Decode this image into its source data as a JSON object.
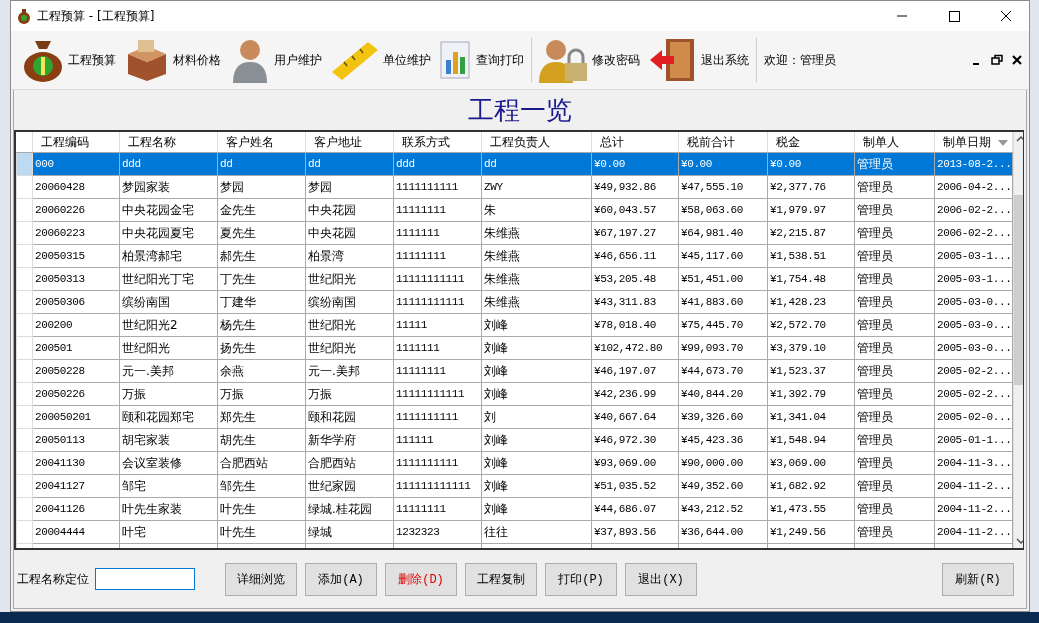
{
  "window": {
    "title": "工程预算 - [工程预算]"
  },
  "toolbar": [
    {
      "kind": "money",
      "label": "工程预算"
    },
    {
      "kind": "box",
      "label": "材料价格"
    },
    {
      "kind": "user",
      "label": "用户维护"
    },
    {
      "kind": "ruler",
      "label": "单位维护"
    },
    {
      "kind": "chart",
      "label": "查询打印"
    },
    {
      "kind": "lock",
      "label": "修改密码"
    },
    {
      "kind": "exit",
      "label": "退出系统"
    }
  ],
  "welcome": "欢迎：管理员",
  "heading": "工程一览",
  "table": {
    "columns": [
      "工程编码",
      "工程名称",
      "客户姓名",
      "客户地址",
      "联系方式",
      "工程负责人",
      "总计",
      "税前合计",
      "税金",
      "制单人",
      "制单日期"
    ],
    "rows": [
      {
        "selected": true,
        "cells": [
          "000",
          "ddd",
          "dd",
          "dd",
          "ddd",
          "dd",
          "¥0.00",
          "¥0.00",
          "¥0.00",
          "管理员",
          "2013-08-2..."
        ]
      },
      {
        "selected": false,
        "cells": [
          "20060428",
          "梦园家装",
          "梦园",
          "梦园",
          "1111111111",
          "ZWY",
          "¥49,932.86",
          "¥47,555.10",
          "¥2,377.76",
          "管理员",
          "2006-04-2..."
        ]
      },
      {
        "selected": false,
        "cells": [
          "20060226",
          "中央花园金宅",
          "金先生",
          "中央花园",
          "11111111",
          "朱",
          "¥60,043.57",
          "¥58,063.60",
          "¥1,979.97",
          "管理员",
          "2006-02-2..."
        ]
      },
      {
        "selected": false,
        "cells": [
          "20060223",
          "中央花园夏宅",
          "夏先生",
          "中央花园",
          "1111111",
          "朱维燕",
          "¥67,197.27",
          "¥64,981.40",
          "¥2,215.87",
          "管理员",
          "2006-02-2..."
        ]
      },
      {
        "selected": false,
        "cells": [
          "20050315",
          "柏景湾郝宅",
          "郝先生",
          "柏景湾",
          "11111111",
          "朱维燕",
          "¥46,656.11",
          "¥45,117.60",
          "¥1,538.51",
          "管理员",
          "2005-03-1..."
        ]
      },
      {
        "selected": false,
        "cells": [
          "20050313",
          "世纪阳光丁宅",
          "丁先生",
          "世纪阳光",
          "11111111111",
          "朱维燕",
          "¥53,205.48",
          "¥51,451.00",
          "¥1,754.48",
          "管理员",
          "2005-03-1..."
        ]
      },
      {
        "selected": false,
        "cells": [
          "20050306",
          "缤纷南国",
          "丁建华",
          "缤纷南国",
          "11111111111",
          "朱维燕",
          "¥43,311.83",
          "¥41,883.60",
          "¥1,428.23",
          "管理员",
          "2005-03-0..."
        ]
      },
      {
        "selected": false,
        "cells": [
          "200200",
          "世纪阳光2",
          "杨先生",
          "世纪阳光",
          "11111",
          "刘峰",
          "¥78,018.40",
          "¥75,445.70",
          "¥2,572.70",
          "管理员",
          "2005-03-0..."
        ]
      },
      {
        "selected": false,
        "cells": [
          "200501",
          "世纪阳光",
          "扬先生",
          "世纪阳光",
          "1111111",
          "刘峰",
          "¥102,472.80",
          "¥99,093.70",
          "¥3,379.10",
          "管理员",
          "2005-03-0..."
        ]
      },
      {
        "selected": false,
        "cells": [
          "20050228",
          "元一.美邦",
          "余燕",
          "元一.美邦",
          "11111111",
          "刘峰",
          "¥46,197.07",
          "¥44,673.70",
          "¥1,523.37",
          "管理员",
          "2005-02-2..."
        ]
      },
      {
        "selected": false,
        "cells": [
          "20050226",
          "万振",
          "万振",
          "万振",
          "11111111111",
          "刘峰",
          "¥42,236.99",
          "¥40,844.20",
          "¥1,392.79",
          "管理员",
          "2005-02-2..."
        ]
      },
      {
        "selected": false,
        "cells": [
          "200050201",
          "颐和花园郑宅",
          "郑先生",
          "颐和花园",
          "1111111111",
          "刘",
          "¥40,667.64",
          "¥39,326.60",
          "¥1,341.04",
          "管理员",
          "2005-02-0..."
        ]
      },
      {
        "selected": false,
        "cells": [
          "20050113",
          "胡宅家装",
          "胡先生",
          "新华学府",
          "111111",
          "刘峰",
          "¥46,972.30",
          "¥45,423.36",
          "¥1,548.94",
          "管理员",
          "2005-01-1..."
        ]
      },
      {
        "selected": false,
        "cells": [
          "20041130",
          "会议室装修",
          "合肥西站",
          "合肥西站",
          "1111111111",
          "刘峰",
          "¥93,069.00",
          "¥90,000.00",
          "¥3,069.00",
          "管理员",
          "2004-11-3..."
        ]
      },
      {
        "selected": false,
        "cells": [
          "20041127",
          "邹宅",
          "邹先生",
          "世纪家园",
          "111111111111",
          "刘峰",
          "¥51,035.52",
          "¥49,352.60",
          "¥1,682.92",
          "管理员",
          "2004-11-2..."
        ]
      },
      {
        "selected": false,
        "cells": [
          "20041126",
          "叶先生家装",
          "叶先生",
          "绿城.桂花园",
          "11111111",
          "刘峰",
          "¥44,686.07",
          "¥43,212.52",
          "¥1,473.55",
          "管理员",
          "2004-11-2..."
        ]
      },
      {
        "selected": false,
        "cells": [
          "20004444",
          "叶宅",
          "叶先生",
          "绿城",
          "1232323",
          "往往",
          "¥37,893.56",
          "¥36,644.00",
          "¥1,249.56",
          "管理员",
          "2004-11-2..."
        ]
      }
    ]
  },
  "locate": {
    "label": "工程名称定位"
  },
  "buttons": [
    {
      "label": "详细浏览",
      "kind": "normal"
    },
    {
      "label": "添加(A)",
      "kind": "normal"
    },
    {
      "label": "删除(D)",
      "kind": "danger"
    },
    {
      "label": "工程复制",
      "kind": "normal"
    },
    {
      "label": "打印(P)",
      "kind": "normal"
    },
    {
      "label": "退出(X)",
      "kind": "normal"
    },
    {
      "label": "刷新(R)",
      "kind": "spaced"
    }
  ]
}
